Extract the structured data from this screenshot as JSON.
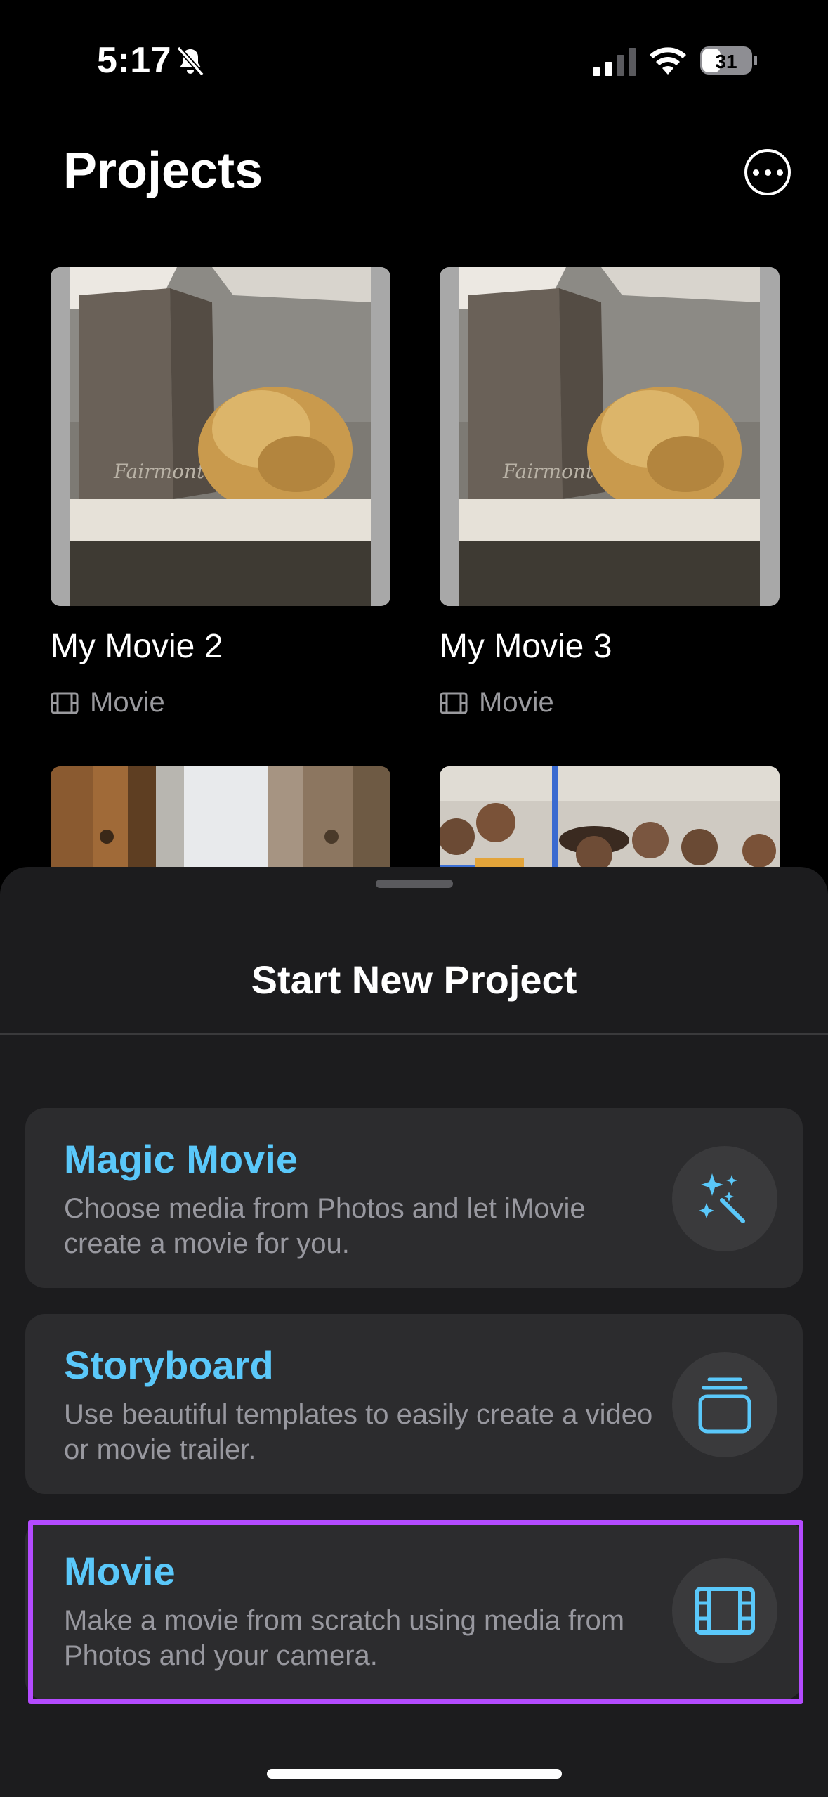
{
  "status_bar": {
    "time": "5:17",
    "battery_level": "31",
    "icons": [
      "bell-slash-icon",
      "cellular-signal-icon",
      "wifi-icon",
      "battery-icon"
    ]
  },
  "header": {
    "title": "Projects",
    "more_button": "ellipsis-circle-icon"
  },
  "projects": [
    {
      "name": "My Movie 2",
      "type": "Movie",
      "type_icon": "film-icon"
    },
    {
      "name": "My Movie 3",
      "type": "Movie",
      "type_icon": "film-icon"
    }
  ],
  "sheet": {
    "title": "Start New Project",
    "options": [
      {
        "title": "Magic Movie",
        "description": "Choose media from Photos and let iMovie create a movie for you.",
        "icon": "magic-wand-icon"
      },
      {
        "title": "Storyboard",
        "description": "Use beautiful templates to easily create a video or movie trailer.",
        "icon": "stack-icon"
      },
      {
        "title": "Movie",
        "description": "Make a movie from scratch using media from Photos and your camera.",
        "icon": "film-icon"
      }
    ]
  },
  "colors": {
    "accent": "#5ac8fa",
    "highlight": "#b44bff",
    "sheet_bg": "#1c1c1e",
    "card_bg": "#2c2c2e"
  }
}
